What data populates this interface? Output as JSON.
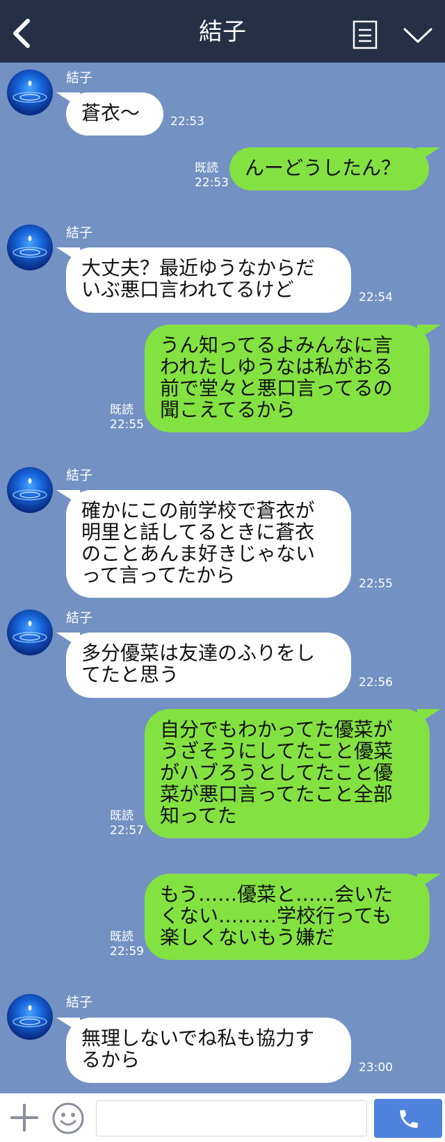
{
  "header": {
    "title": "結子",
    "back_icon": "chevron-left-icon",
    "notes_icon": "document-icon",
    "menu_icon": "chevron-down-icon"
  },
  "messages": [
    {
      "side": "in",
      "sender": "結子",
      "text": "蒼衣〜",
      "time": "22:53"
    },
    {
      "side": "out",
      "read": "既読",
      "text": "んーどうしたん？",
      "time": "22:53"
    },
    {
      "side": "in",
      "sender": "結子",
      "text": "大丈夫？最近ゆうなからだ\nいぶ悪口言われてるけど",
      "time": "22:54"
    },
    {
      "side": "out",
      "read": "既読",
      "text": "うん知ってるよみんなに言\nわれたしゆうなは私がおる\n前で堂々と悪口言ってるの\n聞こえてるから",
      "time": "22:55"
    },
    {
      "side": "in",
      "sender": "結子",
      "text": "確かにこの前学校で蒼衣が\n明里と話してるときに蒼衣\nのことあんま好きじゃない\nって言ってたから",
      "time": "22:55"
    },
    {
      "side": "in",
      "sender": "結子",
      "text": "多分優菜は友達のふりをし\nてたと思う",
      "time": "22:56"
    },
    {
      "side": "out",
      "read": "既読",
      "text": "自分でもわかってた優菜が\nうざそうにしてたこと優菜\nがハブろうとしてたこと優\n菜が悪口言ってたこと全部\n知ってた",
      "time": "22:57"
    },
    {
      "side": "out",
      "read": "既読",
      "text": "もう……優菜と……会いた\nくない………学校行っても\n楽しくないもう嫌だ",
      "time": "22:59"
    },
    {
      "side": "in",
      "sender": "結子",
      "text": "無理しないでね私も協力す\nるから",
      "time": "23:00"
    }
  ],
  "footer": {
    "plus_icon": "plus-icon",
    "emoji_icon": "smiley-icon",
    "input_placeholder": "",
    "call_icon": "phone-icon"
  },
  "colors": {
    "background": "#7391c3",
    "header": "#252f45",
    "outgoing_bubble": "#84e142",
    "incoming_bubble": "#ffffff",
    "call_button": "#4f82dd"
  }
}
